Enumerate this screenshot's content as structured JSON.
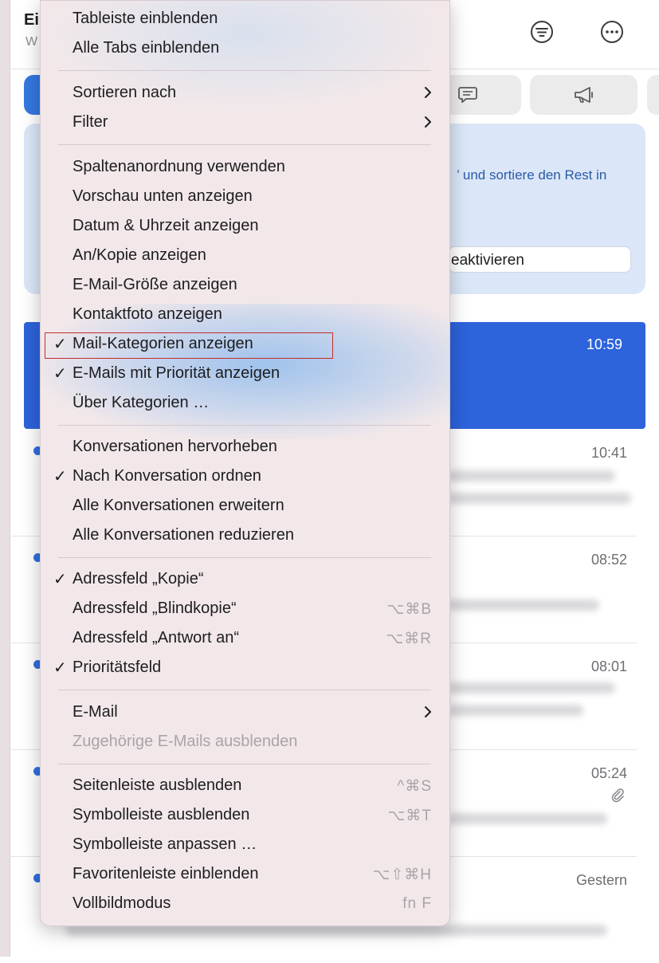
{
  "window": {
    "title": "Ei",
    "subtitle": "W",
    "toolbar_icons": [
      "filter-icon",
      "more-icon"
    ]
  },
  "categories": {
    "tabs": [
      {
        "icon": "person-icon",
        "active": true
      },
      {
        "icon": "chat-icon",
        "active": false
      },
      {
        "icon": "megaphone-icon",
        "active": false
      }
    ]
  },
  "banner": {
    "text": "’ und sortiere den Rest in",
    "button_label": "eaktivieren"
  },
  "messages": [
    {
      "time": "10:59",
      "selected": true,
      "unread": false
    },
    {
      "time": "10:41",
      "selected": false,
      "unread": true
    },
    {
      "time": "08:52",
      "selected": false,
      "unread": true
    },
    {
      "time": "08:01",
      "selected": false,
      "unread": true
    },
    {
      "time": "05:24",
      "selected": false,
      "unread": true,
      "attachment": true
    },
    {
      "time": "Gestern",
      "selected": false,
      "unread": true
    }
  ],
  "menu": {
    "items": [
      {
        "label": "Tableiste einblenden",
        "checked": false
      },
      {
        "label": "Alle Tabs einblenden",
        "checked": false
      },
      {
        "label": "Sortieren nach",
        "submenu": true
      },
      {
        "label": "Filter",
        "submenu": true
      },
      {
        "label": "Spaltenanordnung verwenden"
      },
      {
        "label": "Vorschau unten anzeigen"
      },
      {
        "label": "Datum & Uhrzeit anzeigen"
      },
      {
        "label": "An/Kopie anzeigen"
      },
      {
        "label": "E-Mail-Größe anzeigen"
      },
      {
        "label": "Kontaktfoto anzeigen"
      },
      {
        "label": "Mail-Kategorien anzeigen",
        "checked": true,
        "highlighted": true
      },
      {
        "label": "E-Mails mit Priorität anzeigen",
        "checked": true
      },
      {
        "label": "Über Kategorien …"
      },
      {
        "label": "Konversationen hervorheben"
      },
      {
        "label": "Nach Konversation ordnen",
        "checked": true
      },
      {
        "label": "Alle Konversationen erweitern"
      },
      {
        "label": "Alle Konversationen reduzieren"
      },
      {
        "label": "Adressfeld „Kopie“",
        "checked": true
      },
      {
        "label": "Adressfeld „Blindkopie“",
        "shortcut": "⌥⌘B"
      },
      {
        "label": "Adressfeld „Antwort an“",
        "shortcut": "⌥⌘R"
      },
      {
        "label": "Prioritätsfeld",
        "checked": true
      },
      {
        "label": "E-Mail",
        "submenu": true
      },
      {
        "label": "Zugehörige E-Mails ausblenden",
        "disabled": true
      },
      {
        "label": "Seitenleiste ausblenden",
        "shortcut": "^⌘S"
      },
      {
        "label": "Symbolleiste ausblenden",
        "shortcut": "⌥⌘T"
      },
      {
        "label": "Symbolleiste anpassen …"
      },
      {
        "label": "Favoritenleiste einblenden",
        "shortcut": "⌥⇧⌘H"
      },
      {
        "label": "Vollbildmodus",
        "shortcut": "fn F"
      }
    ],
    "check_glyph": "✓"
  },
  "colors": {
    "accent": "#2d63db",
    "highlight_border": "#c62b2b",
    "menu_bg": "#f2e8ea"
  }
}
